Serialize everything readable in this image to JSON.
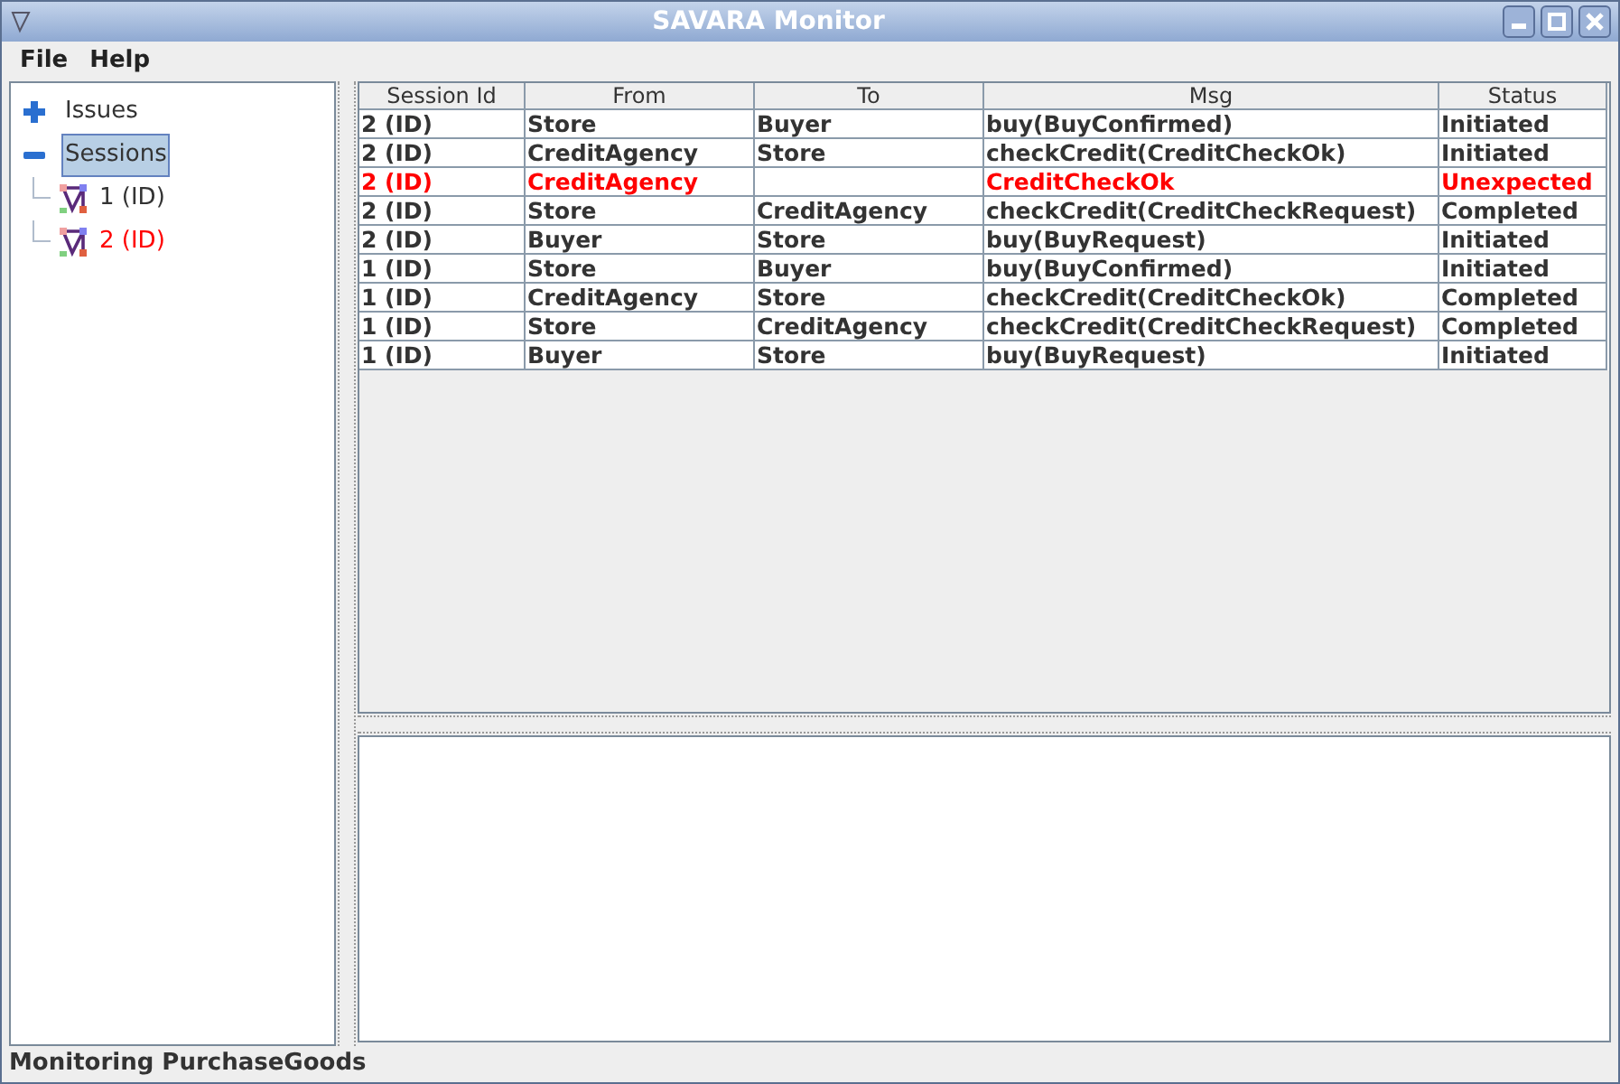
{
  "window": {
    "title": "SAVARA Monitor"
  },
  "menu": [
    "File",
    "Help"
  ],
  "tree": [
    {
      "label": "Issues",
      "expanded": false,
      "selected": false,
      "alert": false
    },
    {
      "label": "Sessions",
      "expanded": true,
      "selected": true,
      "alert": false,
      "children": [
        {
          "label": "1 (ID)",
          "selected": false,
          "alert": false
        },
        {
          "label": "2 (ID)",
          "selected": false,
          "alert": true
        }
      ]
    }
  ],
  "table": {
    "columns": [
      "Session Id",
      "From",
      "To",
      "Msg",
      "Status"
    ],
    "rows": [
      {
        "alert": false,
        "cells": [
          "2 (ID)",
          "Store",
          "Buyer",
          "buy(BuyConfirmed)",
          "Initiated"
        ]
      },
      {
        "alert": false,
        "cells": [
          "2 (ID)",
          "CreditAgency",
          "Store",
          "checkCredit(CreditCheckOk)",
          "Initiated"
        ]
      },
      {
        "alert": true,
        "cells": [
          "2 (ID)",
          "CreditAgency",
          "",
          "CreditCheckOk",
          "Unexpected"
        ]
      },
      {
        "alert": false,
        "cells": [
          "2 (ID)",
          "Store",
          "CreditAgency",
          "checkCredit(CreditCheckRequest)",
          "Completed"
        ]
      },
      {
        "alert": false,
        "cells": [
          "2 (ID)",
          "Buyer",
          "Store",
          "buy(BuyRequest)",
          "Initiated"
        ]
      },
      {
        "alert": false,
        "cells": [
          "1 (ID)",
          "Store",
          "Buyer",
          "buy(BuyConfirmed)",
          "Initiated"
        ]
      },
      {
        "alert": false,
        "cells": [
          "1 (ID)",
          "CreditAgency",
          "Store",
          "checkCredit(CreditCheckOk)",
          "Completed"
        ]
      },
      {
        "alert": false,
        "cells": [
          "1 (ID)",
          "Store",
          "CreditAgency",
          "checkCredit(CreditCheckRequest)",
          "Completed"
        ]
      },
      {
        "alert": false,
        "cells": [
          "1 (ID)",
          "Buyer",
          "Store",
          "buy(BuyRequest)",
          "Initiated"
        ]
      }
    ]
  },
  "status_bar": "Monitoring PurchaseGoods"
}
